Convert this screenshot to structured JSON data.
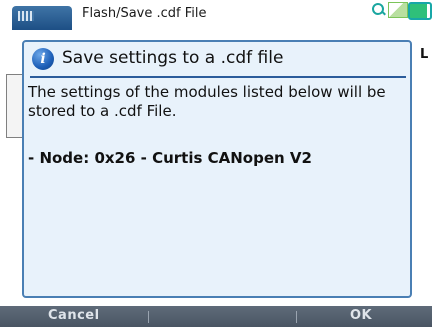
{
  "window": {
    "title": "Flash/Save .cdf File"
  },
  "background": {
    "partial_letter": "L"
  },
  "dialog": {
    "title": "Save settings to a .cdf file",
    "body": "The settings of the modules listed below will be stored to a .cdf File.",
    "node_line": "- Node: 0x26 - Curtis CANopen V2",
    "accent_color": "#4a7fb4"
  },
  "softkeys": {
    "left_label": "Cancel",
    "right_label": "OK"
  },
  "icons": {
    "app": "app-window-icon",
    "info": "info-icon",
    "search": "search-icon",
    "signal": "signal-icon",
    "battery": "battery-icon"
  }
}
